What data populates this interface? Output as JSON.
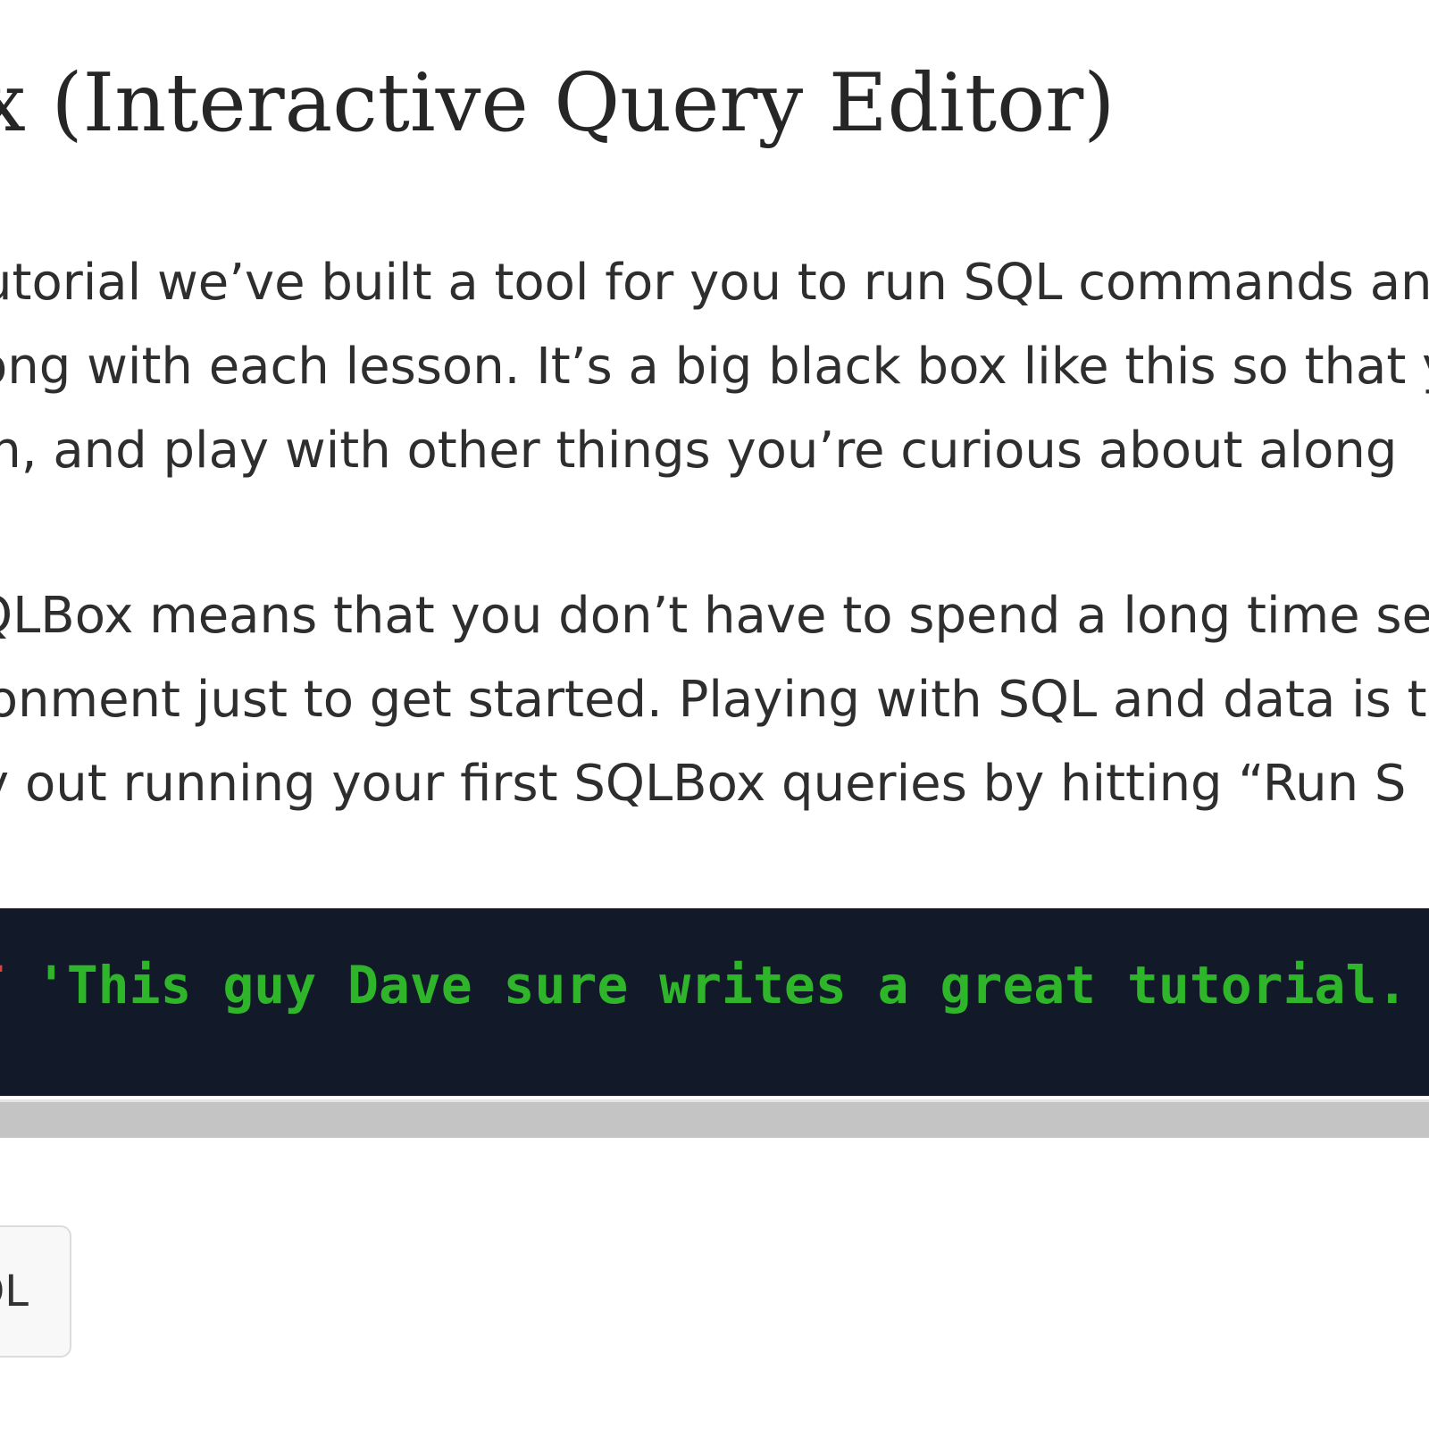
{
  "heading": {
    "text": "ox (Interactive Query Editor)"
  },
  "intro": {
    "lines": [
      "utorial we’ve built a tool for you to run SQL commands an",
      "ong with each lesson. It’s a big black box like this so that y",
      "on, and play with other things you’re curious about along"
    ]
  },
  "details": {
    "lines": [
      "QLBox means that you don’t have to spend a long time set",
      "ronment just to get started. Playing with SQL and data is t",
      "ry out running your first SQLBox queries by hitting “Run S"
    ]
  },
  "editor": {
    "keyword": "T",
    "string": " 'This guy Dave sure writes a great tutorial."
  },
  "run_button": {
    "label": "Run SQL"
  },
  "colors": {
    "editor_background": "#121a2a",
    "keyword": "#e0423a",
    "string": "#2fb52a",
    "text": "#2e2e2e"
  }
}
